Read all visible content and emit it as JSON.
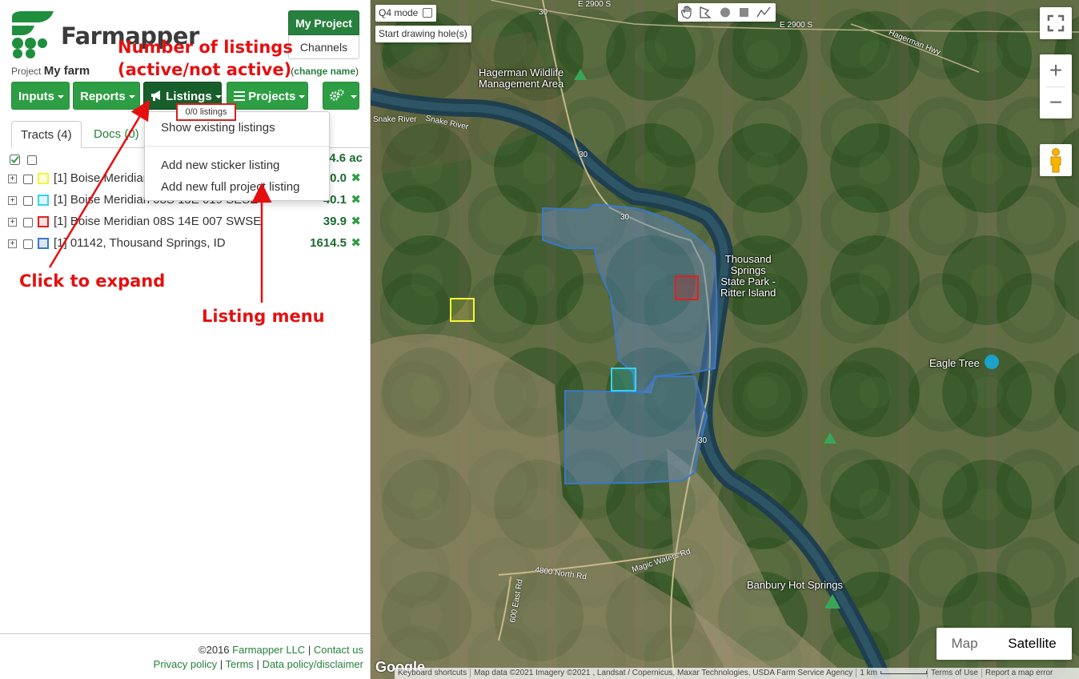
{
  "brand": {
    "name": "Farmapper",
    "green": "#27803d"
  },
  "header": {
    "my_project": "My Project",
    "channels": "Channels",
    "project_prefix": "Project",
    "project_name": "My farm",
    "change_name_open": "(",
    "change_name_link": "change name",
    "change_name_close": ")"
  },
  "toolbar": {
    "inputs": "Inputs",
    "reports": "Reports",
    "listings": "Listings",
    "projects": "Projects"
  },
  "listings_badge": "0/0 listings",
  "listings_menu": {
    "show_existing": "Show existing listings",
    "add_sticker": "Add new sticker listing",
    "add_full": "Add new full project listing"
  },
  "tabs": {
    "tracts": "Tracts (4)",
    "docs": "Docs (0)"
  },
  "total_acres": "1724.6 ac",
  "tracts": [
    {
      "name": "[1] Boise Meridian 08S 14E 006 SENE",
      "acres": "30.0",
      "color": "#f5f53a"
    },
    {
      "name": "[1] Boise Meridian 08S 13E 019 SESE",
      "acres": "40.1",
      "color": "#35d4f0"
    },
    {
      "name": "[1] Boise Meridian 08S 14E 007 SWSE",
      "acres": "39.9",
      "color": "#e02020"
    },
    {
      "name": "[1] 01142, Thousand Springs, ID",
      "acres": "1614.5",
      "color": "#3b78c8"
    }
  ],
  "footer": {
    "copyright": "©2016",
    "company": "Farmapper LLC",
    "sep1": "|",
    "contact": "Contact us",
    "privacy": "Privacy policy",
    "sep2": "|",
    "terms": "Terms",
    "sep3": "|",
    "data_policy": "Data policy/disclaimer"
  },
  "annotations": {
    "number_of_listings_l1": "Number of listings",
    "number_of_listings_l2": "(active/not active)",
    "click_to_expand": "Click to expand",
    "listing_menu": "Listing menu"
  },
  "map": {
    "q4_mode": "Q4 mode",
    "start_drawing": "Start drawing hole(s)",
    "map_btn": "Map",
    "satellite_btn": "Satellite",
    "google": "Google",
    "attribution": {
      "keyboard": "Keyboard shortcuts",
      "data": "Map data ©2021 Imagery ©2021 , Landsat / Copernicus, Maxar Technologies, USDA Farm Service Agency",
      "scale": "1 km",
      "terms": "Terms of Use",
      "report": "Report a map error"
    },
    "places": {
      "hagerman_l1": "Hagerman Wildlife",
      "hagerman_l2": "Management Area",
      "ts_l1": "Thousand",
      "ts_l2": "Springs",
      "ts_l3": "State Park -",
      "ts_l4": "Ritter Island",
      "eagle_tree": "Eagle Tree",
      "banbury": "Banbury Hot Springs"
    },
    "roads": {
      "e2900s": "E 2900 S",
      "e2900s_b": "E 2900 S",
      "hagerman_hwy": "Hagerman Hwy",
      "snake_river": "Snake River",
      "snake_river_b": "Snake River",
      "r30a": "30",
      "r30b": "30",
      "r30c": "30",
      "r30d": "30",
      "magic_waters": "Magic Waters Rd",
      "n4800": "4800 North Rd",
      "e600": "600 East Rd"
    }
  }
}
